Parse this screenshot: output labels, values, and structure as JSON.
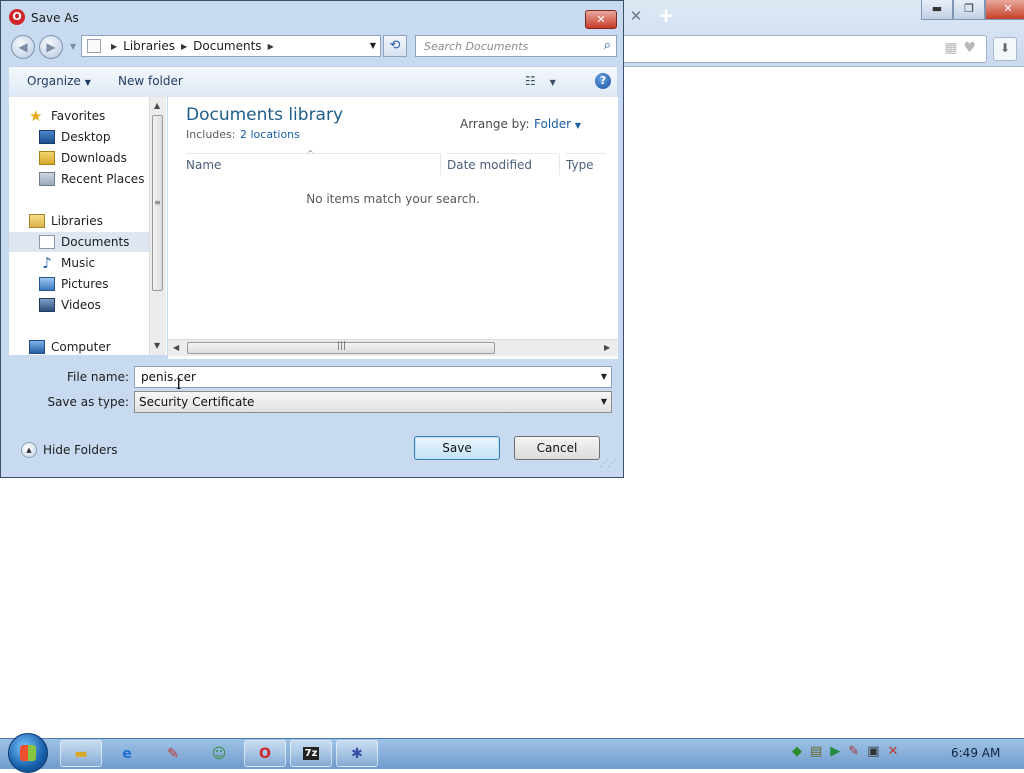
{
  "window": {
    "title": "Save As",
    "close_glyph": "✕"
  },
  "browser": {
    "tab_close_glyph": "✕",
    "new_tab_glyph": "+",
    "minimize_glyph": "▬",
    "restore_glyph": "❐",
    "close_glyph": "✕"
  },
  "address": {
    "path": [
      "Libraries",
      "Documents"
    ]
  },
  "search": {
    "placeholder": "Search Documents"
  },
  "toolbar": {
    "organize_label": "Organize",
    "new_folder_label": "New folder",
    "view_icon": "view-icon",
    "help_icon": "help-icon"
  },
  "sidebar": {
    "favorites_label": "Favorites",
    "favorites": [
      {
        "label": "Desktop",
        "icon": "desktop-icon"
      },
      {
        "label": "Downloads",
        "icon": "downloads-icon"
      },
      {
        "label": "Recent Places",
        "icon": "recent-places-icon"
      }
    ],
    "libraries_label": "Libraries",
    "libraries": [
      {
        "label": "Documents",
        "icon": "documents-icon",
        "selected": true
      },
      {
        "label": "Music",
        "icon": "music-icon"
      },
      {
        "label": "Pictures",
        "icon": "pictures-icon"
      },
      {
        "label": "Videos",
        "icon": "videos-icon"
      }
    ],
    "computer_label": "Computer"
  },
  "content": {
    "library_title": "Documents library",
    "includes_label": "Includes:",
    "includes_link": "2 locations",
    "arrange_by_label": "Arrange by:",
    "arrange_by_value": "Folder",
    "columns": [
      "Name",
      "Date modified",
      "Type"
    ],
    "empty_message": "No items match your search."
  },
  "form": {
    "file_name_label": "File name:",
    "file_name_value": "penis.cer",
    "save_as_type_label": "Save as type:",
    "save_as_type_value": "Security Certificate"
  },
  "footer": {
    "hide_folders_label": "Hide Folders",
    "save_label": "Save",
    "cancel_label": "Cancel"
  },
  "taskbar": {
    "apps": [
      "explorer",
      "internet-explorer",
      "paint",
      "messenger",
      "opera",
      "7zip",
      "app"
    ],
    "clock": "6:49 AM"
  },
  "colors": {
    "dialog_frame": "#c7daf0",
    "library_title": "#1e5e8a",
    "link": "#1a5ea8",
    "close_red": "#c63b27"
  }
}
